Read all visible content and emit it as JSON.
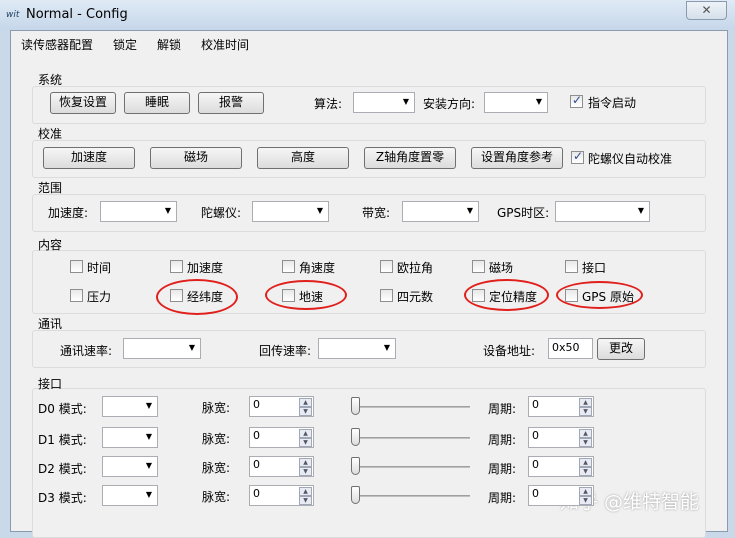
{
  "window": {
    "title": "Normal - Config",
    "icon": "wit",
    "close": "✕"
  },
  "menu": [
    "读传感器配置",
    "锁定",
    "解锁",
    "校准时间"
  ],
  "system": {
    "label": "系统",
    "buttons": [
      "恢复设置",
      "睡眠",
      "报警"
    ],
    "algo_label": "算法:",
    "mount_label": "安装方向:",
    "cmd_start": "指令启动",
    "cmd_start_checked": true
  },
  "calib": {
    "label": "校准",
    "buttons": [
      "加速度",
      "磁场",
      "高度",
      "Z轴角度置零",
      "设置角度参考"
    ],
    "gyro_auto": "陀螺仪自动校准",
    "gyro_auto_checked": true
  },
  "range": {
    "label": "范围",
    "items": [
      "加速度:",
      "陀螺仪:",
      "带宽:",
      "GPS时区:"
    ]
  },
  "content": {
    "label": "内容",
    "row1": [
      "时间",
      "加速度",
      "角速度",
      "欧拉角",
      "磁场",
      "接口"
    ],
    "row2": [
      "压力",
      "经纬度",
      "地速",
      "四元数",
      "定位精度",
      "GPS 原始"
    ]
  },
  "comm": {
    "label": "通讯",
    "rate_label": "通讯速率:",
    "return_label": "回传速率:",
    "addr_label": "设备地址:",
    "addr_value": "0x50",
    "change": "更改"
  },
  "port": {
    "label": "接口",
    "rows": [
      {
        "name": "D0 模式:",
        "pw_label": "脉宽:",
        "pw": "0",
        "period_label": "周期:",
        "period": "0",
        "slider": 0
      },
      {
        "name": "D1 模式:",
        "pw_label": "脉宽:",
        "pw": "0",
        "period_label": "周期:",
        "period": "0",
        "slider": 0
      },
      {
        "name": "D2 模式:",
        "pw_label": "脉宽:",
        "pw": "0",
        "period_label": "周期:",
        "period": "0",
        "slider": 0
      },
      {
        "name": "D3 模式:",
        "pw_label": "脉宽:",
        "pw": "0",
        "period_label": "周期:",
        "period": "0",
        "slider": 0
      }
    ]
  },
  "watermark": "知乎 @维特智能",
  "colors": {
    "highlight": "#e0201c"
  }
}
